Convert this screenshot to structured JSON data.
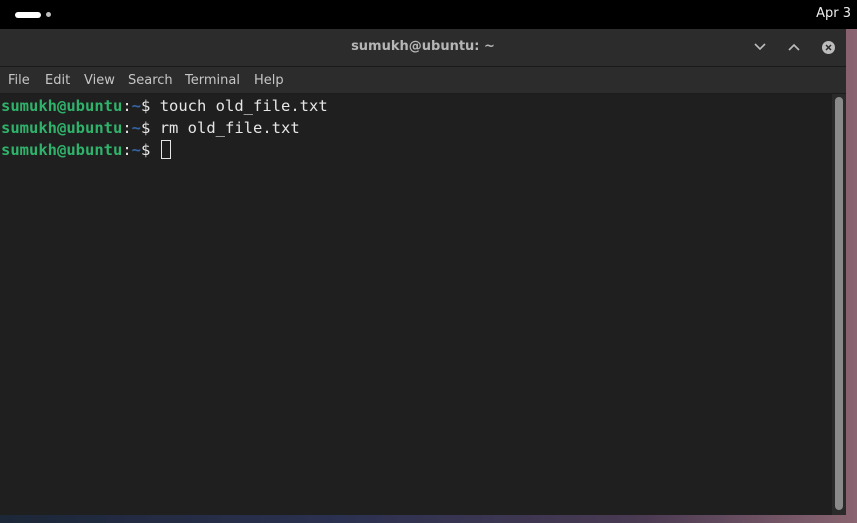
{
  "topbar": {
    "clock": "Apr 3"
  },
  "window": {
    "title": "sumukh@ubuntu: ~",
    "buttons": {
      "minimize_icon": "chevron-down-icon",
      "maximize_icon": "chevron-up-icon",
      "close_icon": "close-icon"
    }
  },
  "menu": {
    "items": [
      "File",
      "Edit",
      "View",
      "Search",
      "Terminal",
      "Help"
    ]
  },
  "terminal": {
    "lines": [
      {
        "user": "sumukh@ubuntu",
        "sep": ":",
        "path": "~",
        "dollar": "$ ",
        "command": "touch old_file.txt"
      },
      {
        "user": "sumukh@ubuntu",
        "sep": ":",
        "path": "~",
        "dollar": "$ ",
        "command": "rm old_file.txt"
      },
      {
        "user": "sumukh@ubuntu",
        "sep": ":",
        "path": "~",
        "dollar": "$ ",
        "command": ""
      }
    ]
  },
  "colors": {
    "prompt_user": "#2fb36b",
    "prompt_path": "#3465a4",
    "terminal_bg": "#1f1f1f",
    "titlebar_bg": "#2c2c2c"
  }
}
